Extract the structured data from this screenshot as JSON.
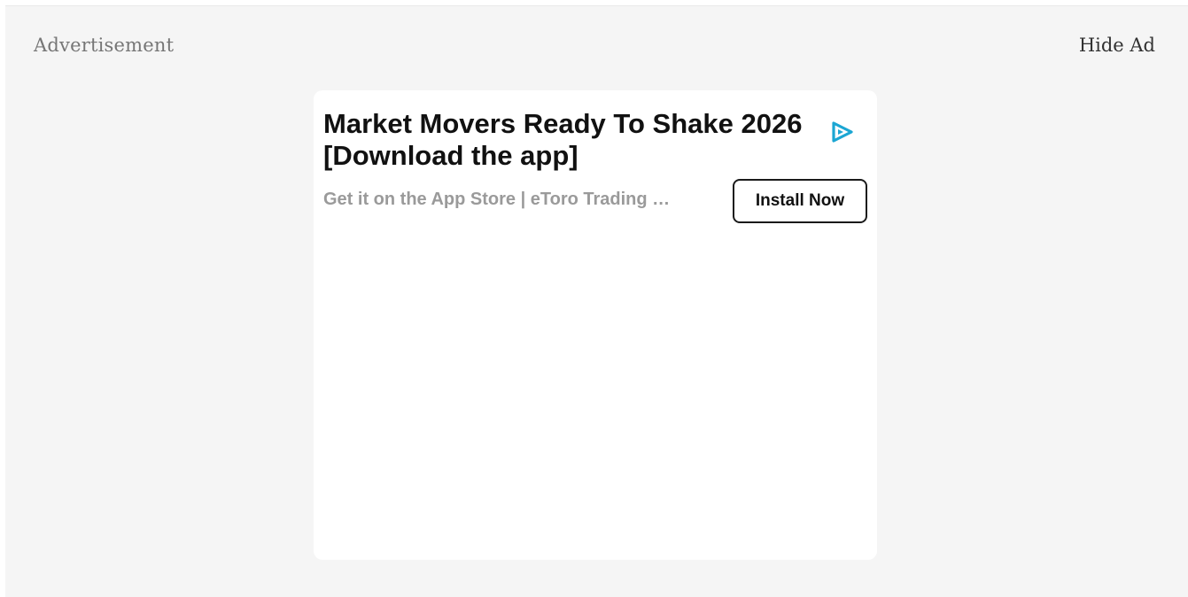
{
  "ad": {
    "label": "Advertisement",
    "hide_label": "Hide Ad",
    "card": {
      "headline": "Market Movers Ready To Shake 2026 [Download the app]",
      "subline": "Get it on the App Store | eToro Trading …",
      "cta_label": "Install Now",
      "adchoices_icon": "adchoices-icon",
      "accent_color": "#1ba6d3"
    }
  }
}
